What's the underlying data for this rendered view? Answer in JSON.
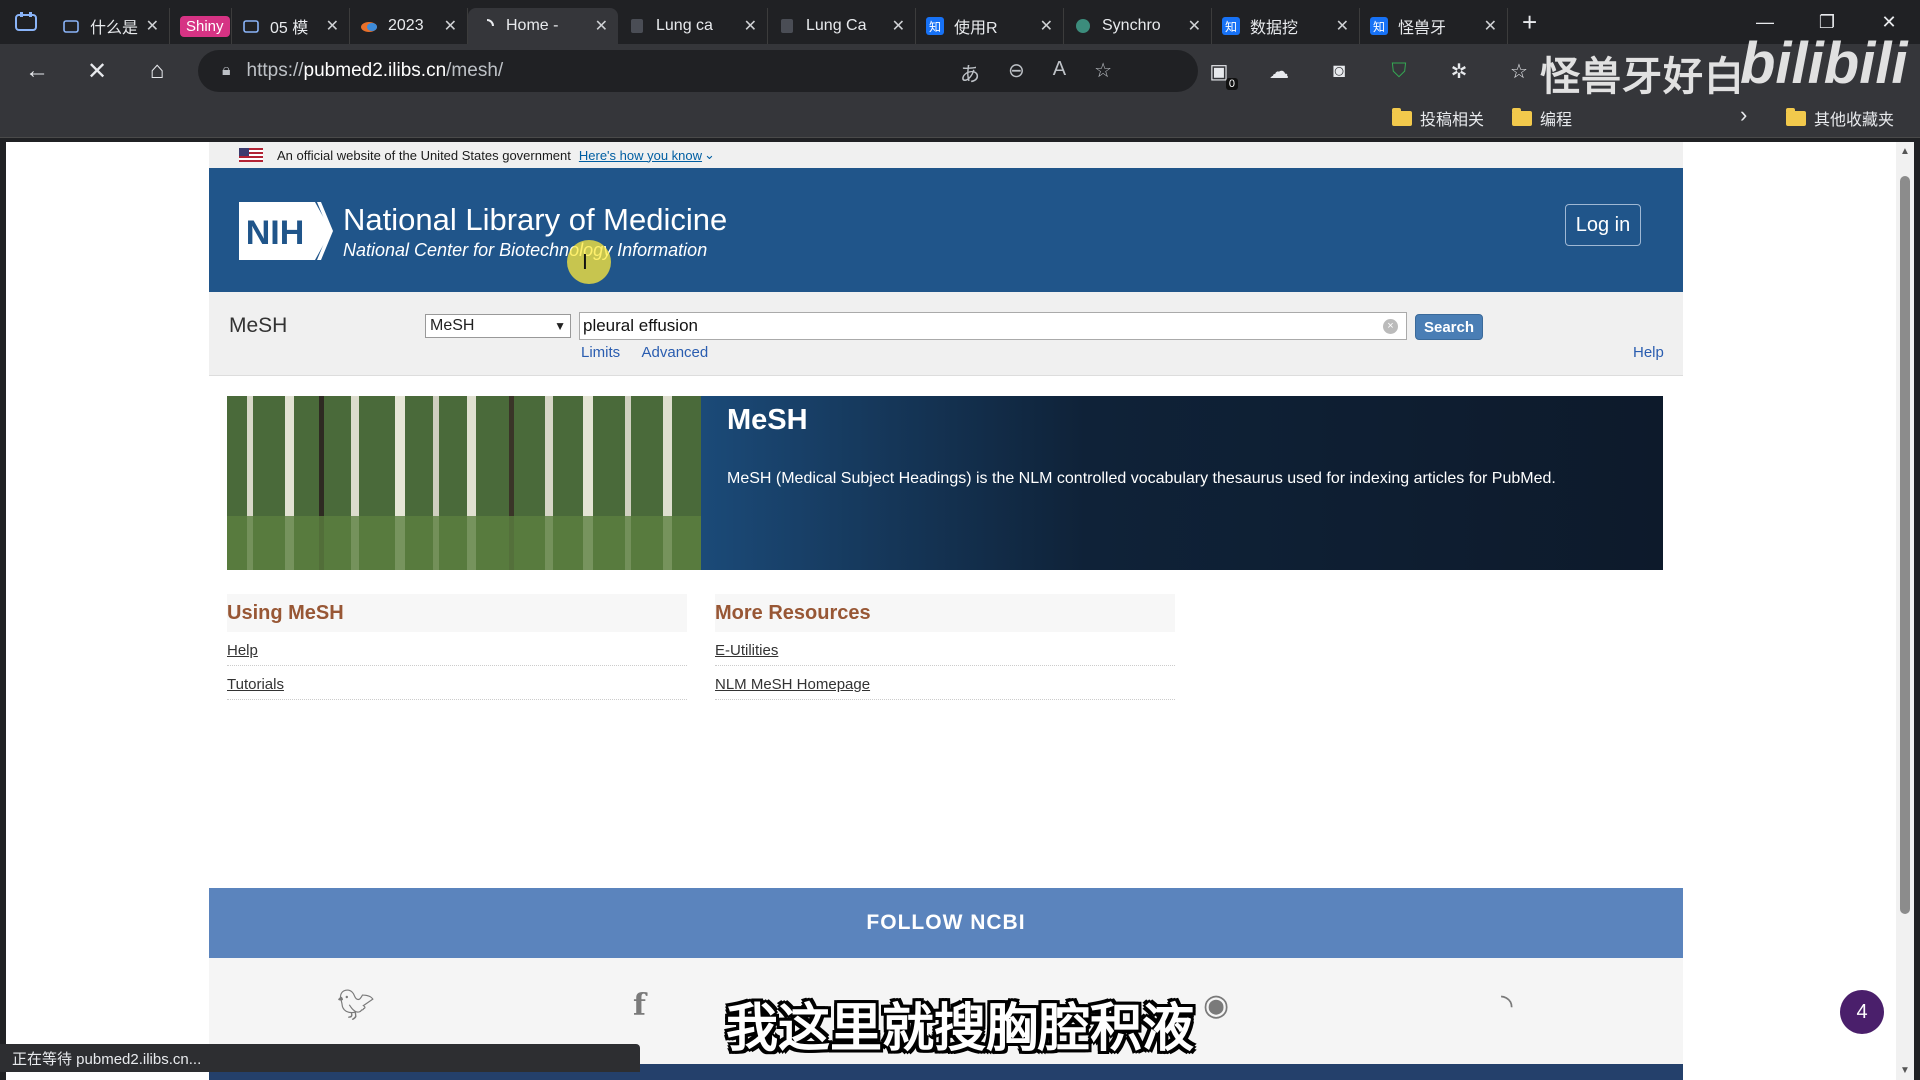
{
  "browser": {
    "tabs": [
      {
        "title": "什么是",
        "active": false
      },
      {
        "title": "",
        "badge": "Shiny",
        "active": false
      },
      {
        "title": "05 模",
        "active": false
      },
      {
        "title": "2023",
        "active": false
      },
      {
        "title": "Home -",
        "active": true
      },
      {
        "title": "Lung ca",
        "active": false
      },
      {
        "title": "Lung Ca",
        "active": false
      },
      {
        "title": "使用R",
        "active": false
      },
      {
        "title": "Synchro",
        "active": false
      },
      {
        "title": "数据挖",
        "active": false
      },
      {
        "title": "怪兽牙",
        "active": false
      }
    ],
    "url_prefix": "https://",
    "url_host": "pubmed2.ilibs.cn",
    "url_path": "/mesh/",
    "bookmarks": [
      "投稿相关",
      "编程",
      "其他收藏夹"
    ],
    "status_text": "正在等待 pubmed2.ilibs.cn...",
    "extension_badge": "0"
  },
  "overlay": {
    "watermark": "怪兽牙好白",
    "bili_logo": "bilibili",
    "subtitle": "我这里就搜胸腔积液",
    "bubble_count": "4"
  },
  "gov_banner": {
    "text": "An official website of the United States government",
    "link": "Here's how you know"
  },
  "header": {
    "logo_text": "NIH",
    "title": "National Library of Medicine",
    "subtitle": "National Center for Biotechnology Information",
    "login_label": "Log in"
  },
  "search": {
    "db_label": "MeSH",
    "db_selected": "MeSH",
    "query": "pleural effusion",
    "button_label": "Search",
    "limits_label": "Limits",
    "advanced_label": "Advanced",
    "help_label": "Help"
  },
  "hero": {
    "title": "MeSH",
    "description": "MeSH (Medical Subject Headings) is the NLM controlled vocabulary thesaurus used for indexing articles for PubMed."
  },
  "using": {
    "heading": "Using MeSH",
    "links": [
      "Help",
      "Tutorials"
    ]
  },
  "resources": {
    "heading": "More Resources",
    "links": [
      "E-Utilities",
      "NLM MeSH Homepage"
    ]
  },
  "footer": {
    "follow_label": "FOLLOW NCBI"
  },
  "colors": {
    "nlm_blue": "#20558a",
    "follow_blue": "#5b84bd",
    "heading_brown": "#985735",
    "link_blue": "#2a5db0"
  }
}
